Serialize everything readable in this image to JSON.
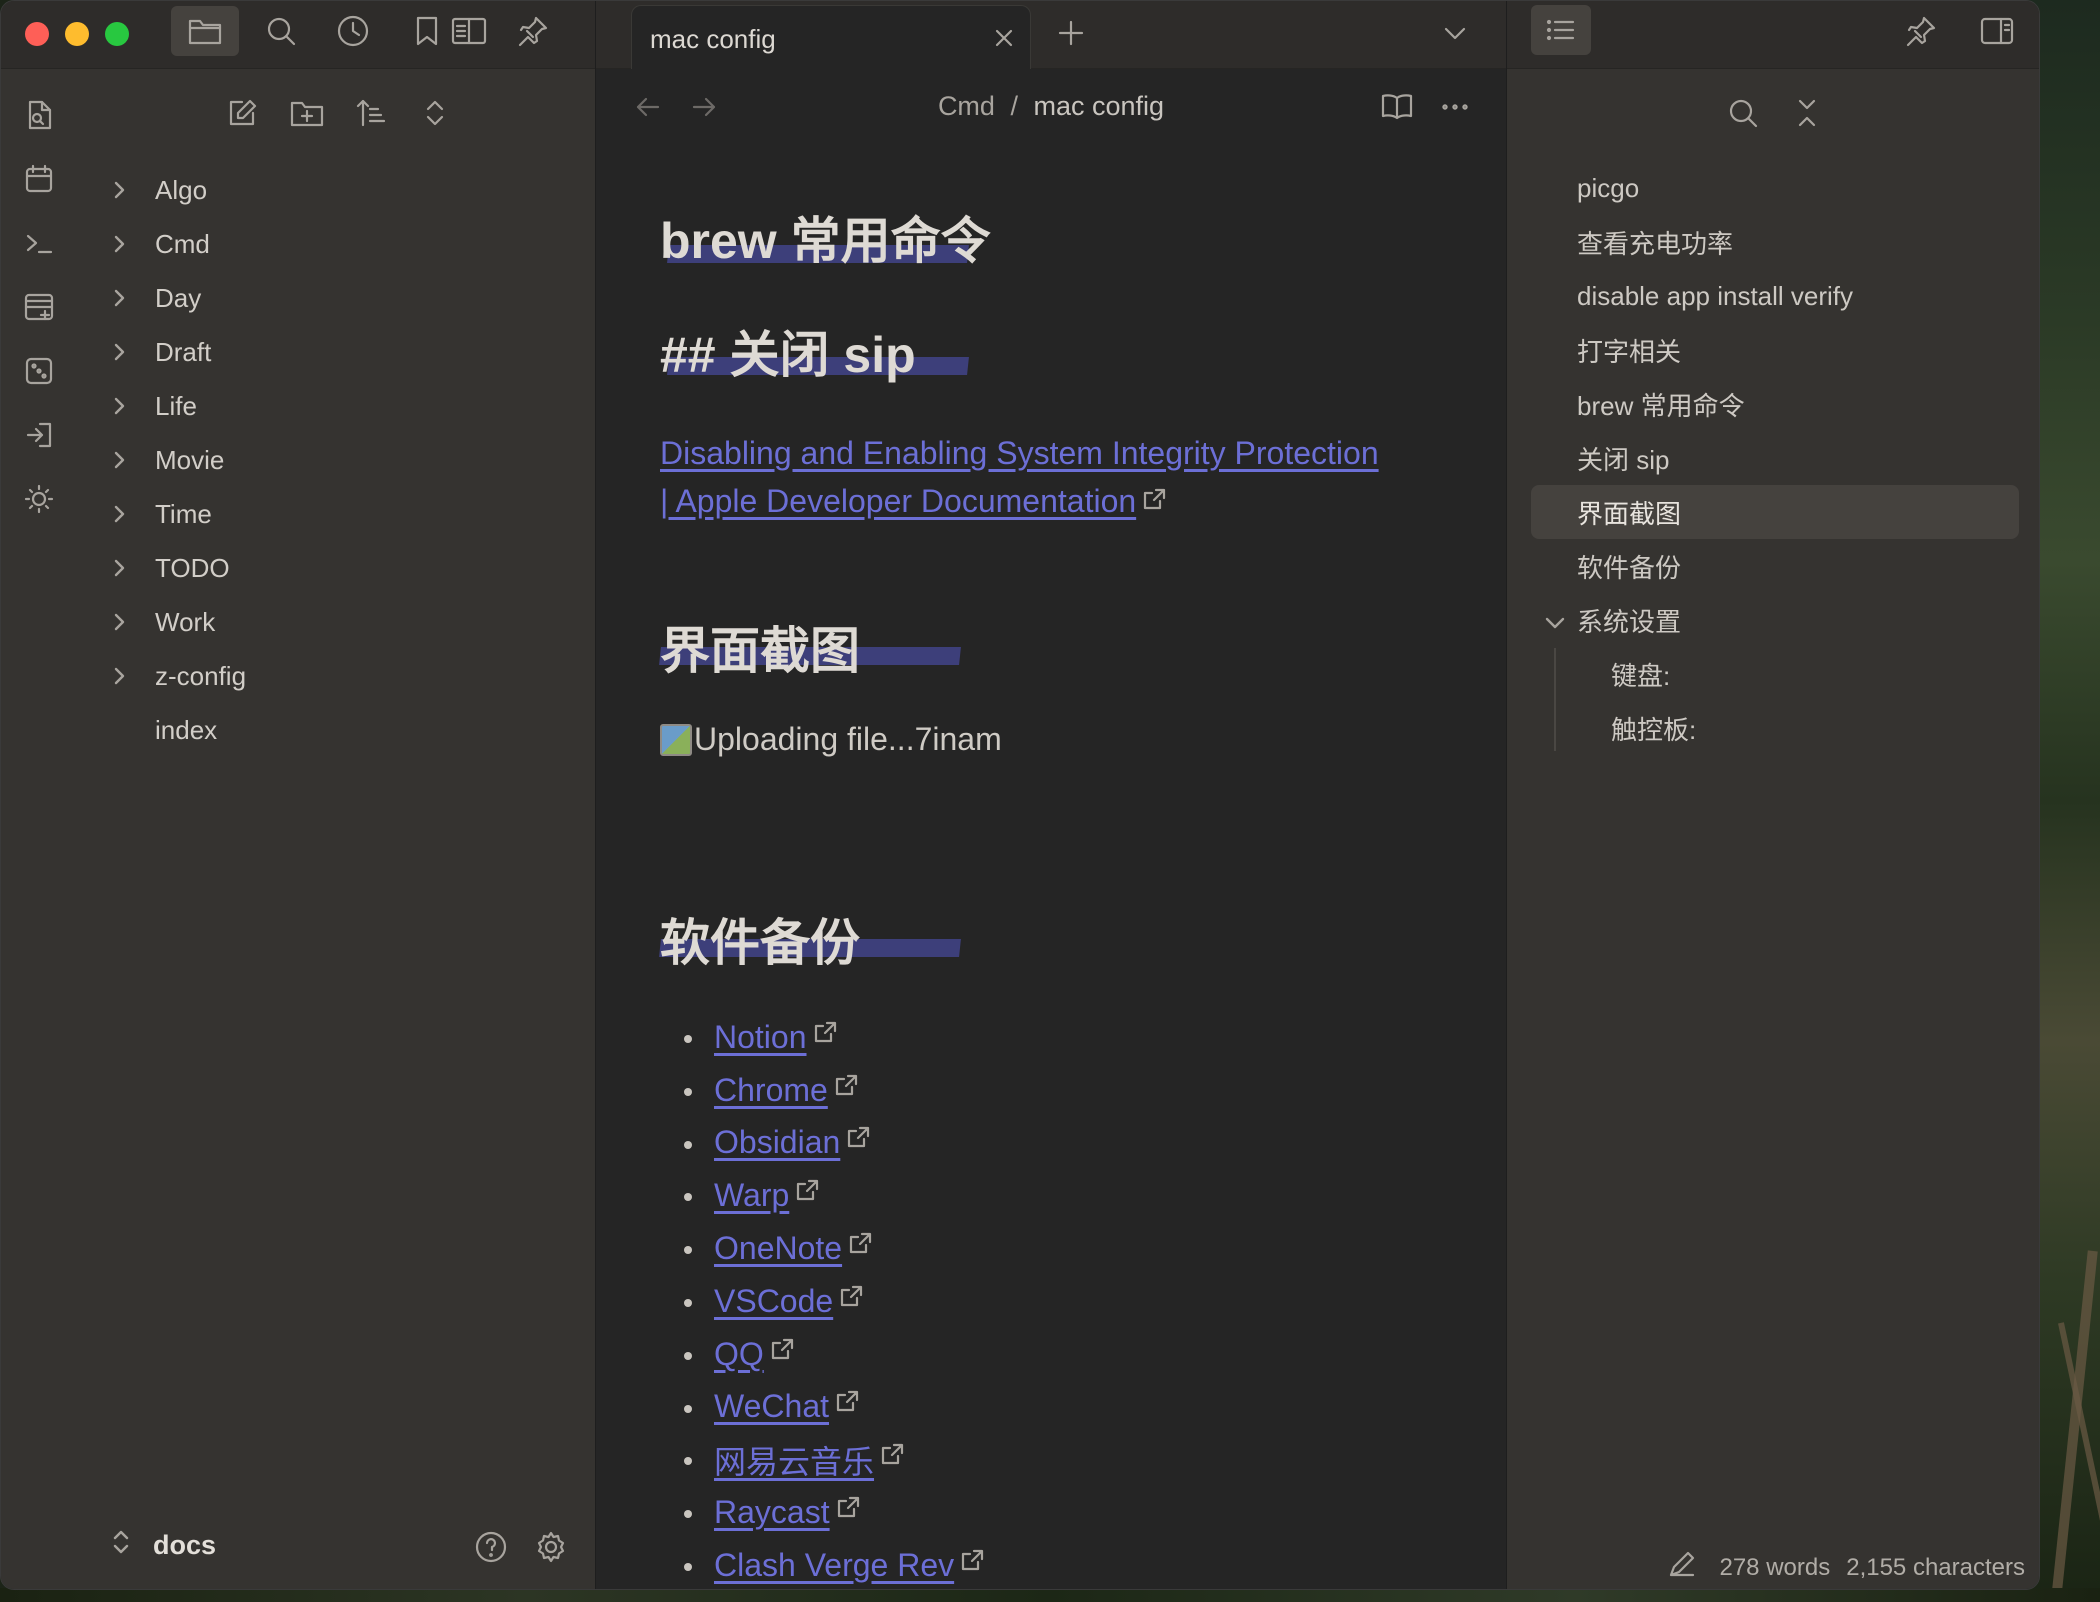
{
  "app": {
    "accent_link_color": "#6c6fd6",
    "highlight_color": "#3d3f7a"
  },
  "left_toolbar": {
    "icons": [
      "folder-icon",
      "search-icon",
      "clock-icon",
      "bookmark-icon",
      "reading-view-icon",
      "pin-icon"
    ]
  },
  "ribbon": {
    "icons": [
      "file-search-icon",
      "calendar-icon",
      "terminal-icon",
      "new-canvas-icon",
      "dice-icon",
      "login-icon",
      "sun-icon"
    ]
  },
  "explorer_toolbar": {
    "icons": [
      "new-note-icon",
      "new-folder-icon",
      "sort-icon",
      "collapse-icon"
    ]
  },
  "file_tree": [
    {
      "label": "Algo",
      "folder": true
    },
    {
      "label": "Cmd",
      "folder": true
    },
    {
      "label": "Day",
      "folder": true
    },
    {
      "label": "Draft",
      "folder": true
    },
    {
      "label": "Life",
      "folder": true
    },
    {
      "label": "Movie",
      "folder": true
    },
    {
      "label": "Time",
      "folder": true
    },
    {
      "label": "TODO",
      "folder": true
    },
    {
      "label": "Work",
      "folder": true
    },
    {
      "label": "z-config",
      "folder": true
    },
    {
      "label": "index",
      "folder": false
    }
  ],
  "vault": {
    "name": "docs"
  },
  "tab": {
    "title": "mac config"
  },
  "editor": {
    "breadcrumb": {
      "folder": "Cmd",
      "separator": "/",
      "note": "mac config"
    },
    "heading1": "brew 常用命令",
    "heading2": "## 关闭 sip",
    "sip_link_line1": "Disabling and Enabling System Integrity Protection ",
    "sip_link_line2": "| Apple Developer Documentation",
    "heading3": "界面截图",
    "image_alt": "Uploading file...7inam",
    "heading4": "软件备份",
    "software_links": [
      "Notion",
      "Chrome",
      "Obsidian",
      "Warp",
      "OneNote",
      "VSCode",
      "QQ",
      "WeChat",
      "网易云音乐",
      "Raycast",
      "Clash Verge Rev"
    ]
  },
  "outline": {
    "items": [
      {
        "label": "picgo",
        "level": 1
      },
      {
        "label": "查看充电功率",
        "level": 1
      },
      {
        "label": "disable app install verify",
        "level": 1
      },
      {
        "label": "打字相关",
        "level": 1
      },
      {
        "label": "brew 常用命令",
        "level": 1
      },
      {
        "label": "关闭 sip",
        "level": 1
      },
      {
        "label": "界面截图",
        "level": 1,
        "selected": true
      },
      {
        "label": "软件备份",
        "level": 1
      },
      {
        "label": "系统设置",
        "level": 1,
        "expanded": true
      },
      {
        "label": "键盘:",
        "level": 2
      },
      {
        "label": "触控板:",
        "level": 2
      }
    ]
  },
  "status_bar": {
    "words": "278 words",
    "characters": "2,155 characters"
  }
}
